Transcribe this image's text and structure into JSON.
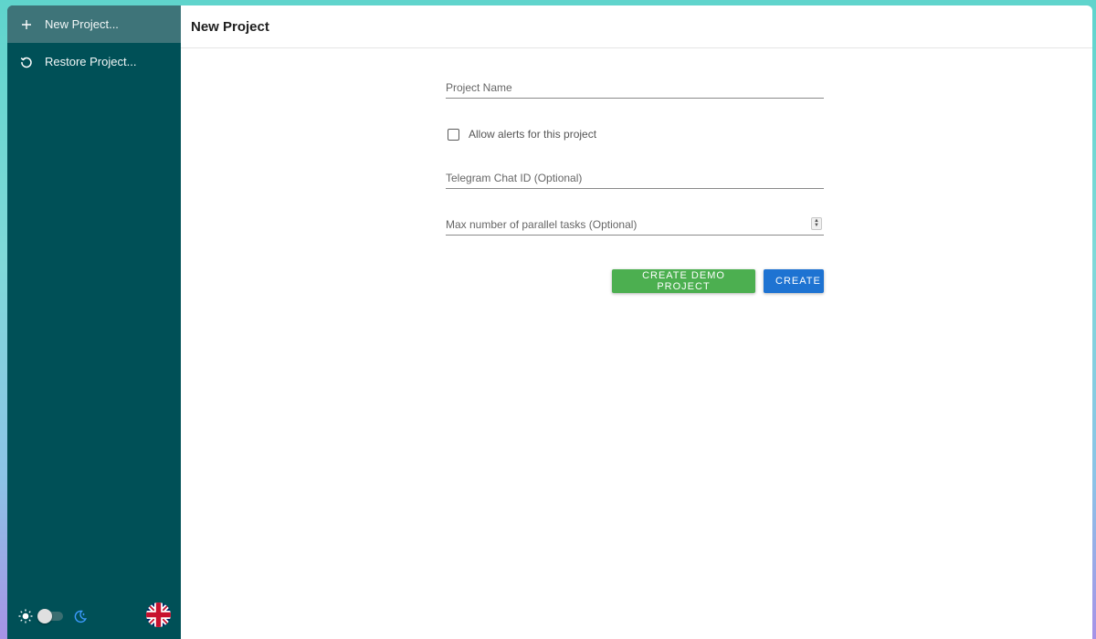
{
  "sidebar": {
    "items": [
      {
        "label": "New Project...",
        "icon": "plus-icon",
        "active": true
      },
      {
        "label": "Restore Project...",
        "icon": "restore-icon",
        "active": false
      }
    ],
    "footer": {
      "theme_toggle": {
        "light_icon": "sun-icon",
        "dark_icon": "moon-icon",
        "dark_mode": false
      },
      "language_icon": "uk-flag-icon"
    }
  },
  "header": {
    "title": "New Project"
  },
  "form": {
    "project_name": {
      "placeholder": "Project Name",
      "value": ""
    },
    "allow_alerts": {
      "label": "Allow alerts for this project",
      "checked": false
    },
    "telegram_chat_id": {
      "placeholder": "Telegram Chat ID (Optional)",
      "value": ""
    },
    "max_parallel_tasks": {
      "placeholder": "Max number of parallel tasks (Optional)",
      "value": ""
    }
  },
  "buttons": {
    "create_demo": "CREATE DEMO PROJECT",
    "create": "CREATE"
  },
  "colors": {
    "sidebar_bg": "#005057",
    "sidebar_active": "#3e7479",
    "demo_button": "#4caf50",
    "create_button": "#1e73d2"
  }
}
